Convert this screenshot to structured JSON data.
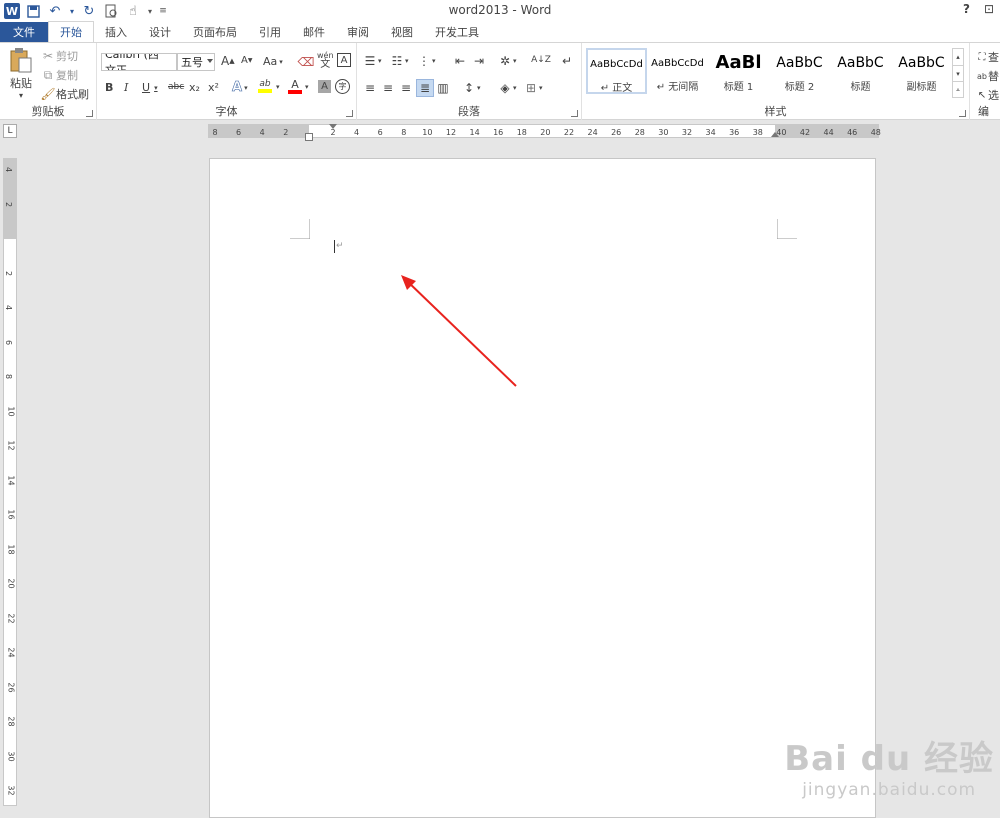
{
  "titlebar": {
    "title": "word2013 - Word",
    "app_icon": "W",
    "help": "?",
    "restore": "⊡"
  },
  "tabs": [
    "文件",
    "开始",
    "插入",
    "设计",
    "页面布局",
    "引用",
    "邮件",
    "审阅",
    "视图",
    "开发工具"
  ],
  "active_tab": "开始",
  "clipboard": {
    "paste": "粘贴",
    "cut": "剪切",
    "copy": "复制",
    "format_painter": "格式刷",
    "group_label": "剪贴板"
  },
  "font": {
    "font_name": "Calibri (西文正",
    "font_size": "五号",
    "group_label": "字体",
    "grow": "A",
    "shrink": "A",
    "change_case": "Aa",
    "phonetic": "wén",
    "phonetic_char": "文",
    "bold": "B",
    "italic": "I",
    "underline": "U",
    "strike": "abc",
    "subscript": "x₂",
    "superscript": "x²",
    "text_effect": "A",
    "highlight": "ab",
    "font_color": "A",
    "char_shading": "A",
    "enclose": "字"
  },
  "paragraph": {
    "group_label": "段落"
  },
  "styles": {
    "group_label": "样式",
    "items": [
      {
        "sample": "AaBbCcDd",
        "name": "↵ 正文"
      },
      {
        "sample": "AaBbCcDd",
        "name": "↵ 无间隔"
      },
      {
        "sample": "AaBl",
        "name": "标题 1"
      },
      {
        "sample": "AaBbC",
        "name": "标题 2"
      },
      {
        "sample": "AaBbC",
        "name": "标题"
      },
      {
        "sample": "AaBbC",
        "name": "副标题"
      }
    ]
  },
  "editing": {
    "find": "查",
    "replace": "替",
    "select": "选",
    "group_label": "编"
  },
  "ruler": {
    "horizontal_ticks": [
      "8",
      "6",
      "4",
      "2",
      "2",
      "4",
      "6",
      "8",
      "10",
      "12",
      "14",
      "16",
      "18",
      "20",
      "22",
      "24",
      "26",
      "28",
      "30",
      "32",
      "34",
      "36",
      "38",
      "40",
      "42",
      "44",
      "46",
      "48"
    ],
    "vertical_ticks": [
      "4",
      "2",
      "2",
      "4",
      "6",
      "8",
      "10",
      "12",
      "14",
      "16",
      "18",
      "20",
      "22",
      "24",
      "26",
      "28",
      "30",
      "32"
    ],
    "corner": "L"
  },
  "document": {
    "paragraph_mark": "↵"
  },
  "annotation": {
    "color": "#e8231e"
  },
  "watermark": {
    "line1": "Bai du 经验",
    "line2": "jingyan.baidu.com"
  },
  "colors": {
    "accent": "#2b579a",
    "highlight_yellow": "#ffff00",
    "font_red": "#ff0000"
  }
}
